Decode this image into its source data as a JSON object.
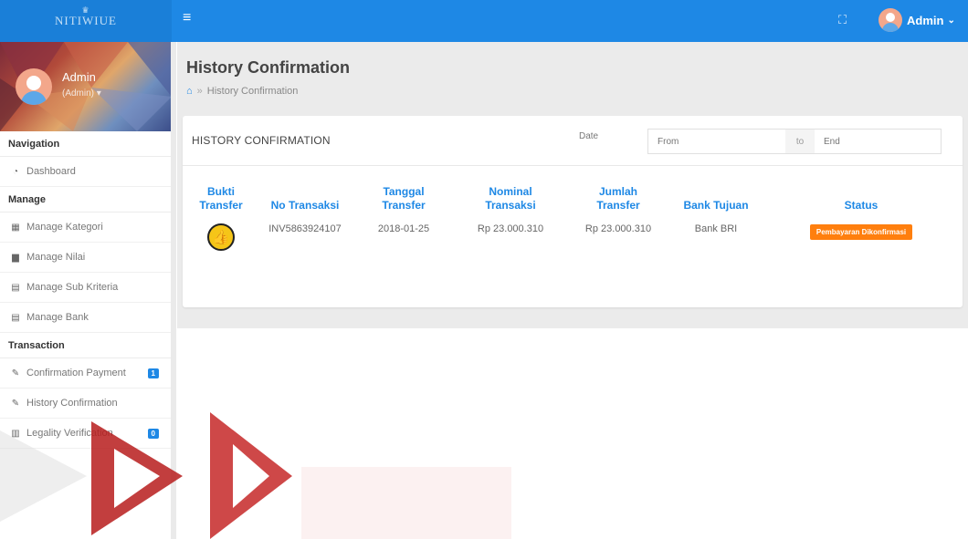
{
  "colors": {
    "accent": "#1e88e5",
    "status_badge": "#ff7f0e",
    "watermark": "#c62828"
  },
  "header": {
    "brand": "NITIWIUE",
    "menu_icon": "hamburger-icon",
    "fullscreen_icon": "fullscreen-icon",
    "user_label": "Admin",
    "user_caret": "⌄"
  },
  "sidebar": {
    "profile": {
      "name": "Admin",
      "role": "(Admin) ▾"
    },
    "sections": [
      {
        "title": "Navigation"
      },
      {
        "title": "Manage"
      },
      {
        "title": "Transaction"
      }
    ],
    "items": [
      {
        "label": "Dashboard",
        "icon": "dashboard-icon"
      },
      {
        "label": "Manage Kategori",
        "icon": "grid-icon"
      },
      {
        "label": "Manage Nilai",
        "icon": "book-icon"
      },
      {
        "label": "Manage Sub Kriteria",
        "icon": "table-icon"
      },
      {
        "label": "Manage Bank",
        "icon": "table-icon"
      },
      {
        "label": "Confirmation Payment",
        "icon": "pencil-icon",
        "badge": "1"
      },
      {
        "label": "History Confirmation",
        "icon": "pencil-icon"
      },
      {
        "label": "Legality Verification",
        "icon": "document-icon",
        "badge": "0"
      }
    ]
  },
  "page": {
    "title": "History Confirmation",
    "breadcrumb": "History Confirmation",
    "breadcrumb_sep": "»"
  },
  "card": {
    "title": "HISTORY CONFIRMATION",
    "date_label": "Date",
    "date_from_placeholder": "From",
    "date_to": "to",
    "date_end_placeholder": "End"
  },
  "table": {
    "columns": [
      "Bukti Transfer",
      "No Transaksi",
      "Tanggal Transfer",
      "Nominal Transaksi",
      "Jumlah Transfer",
      "Bank Tujuan",
      "Status"
    ],
    "rows": [
      {
        "bukti_icon": "thumbs-up-icon",
        "no_transaksi": "INV5863924107",
        "tanggal": "2018-01-25",
        "nominal": "Rp 23.000.310",
        "jumlah": "Rp 23.000.310",
        "bank": "Bank BRI",
        "status": "Pembayaran Dikonfirmasi"
      }
    ]
  }
}
